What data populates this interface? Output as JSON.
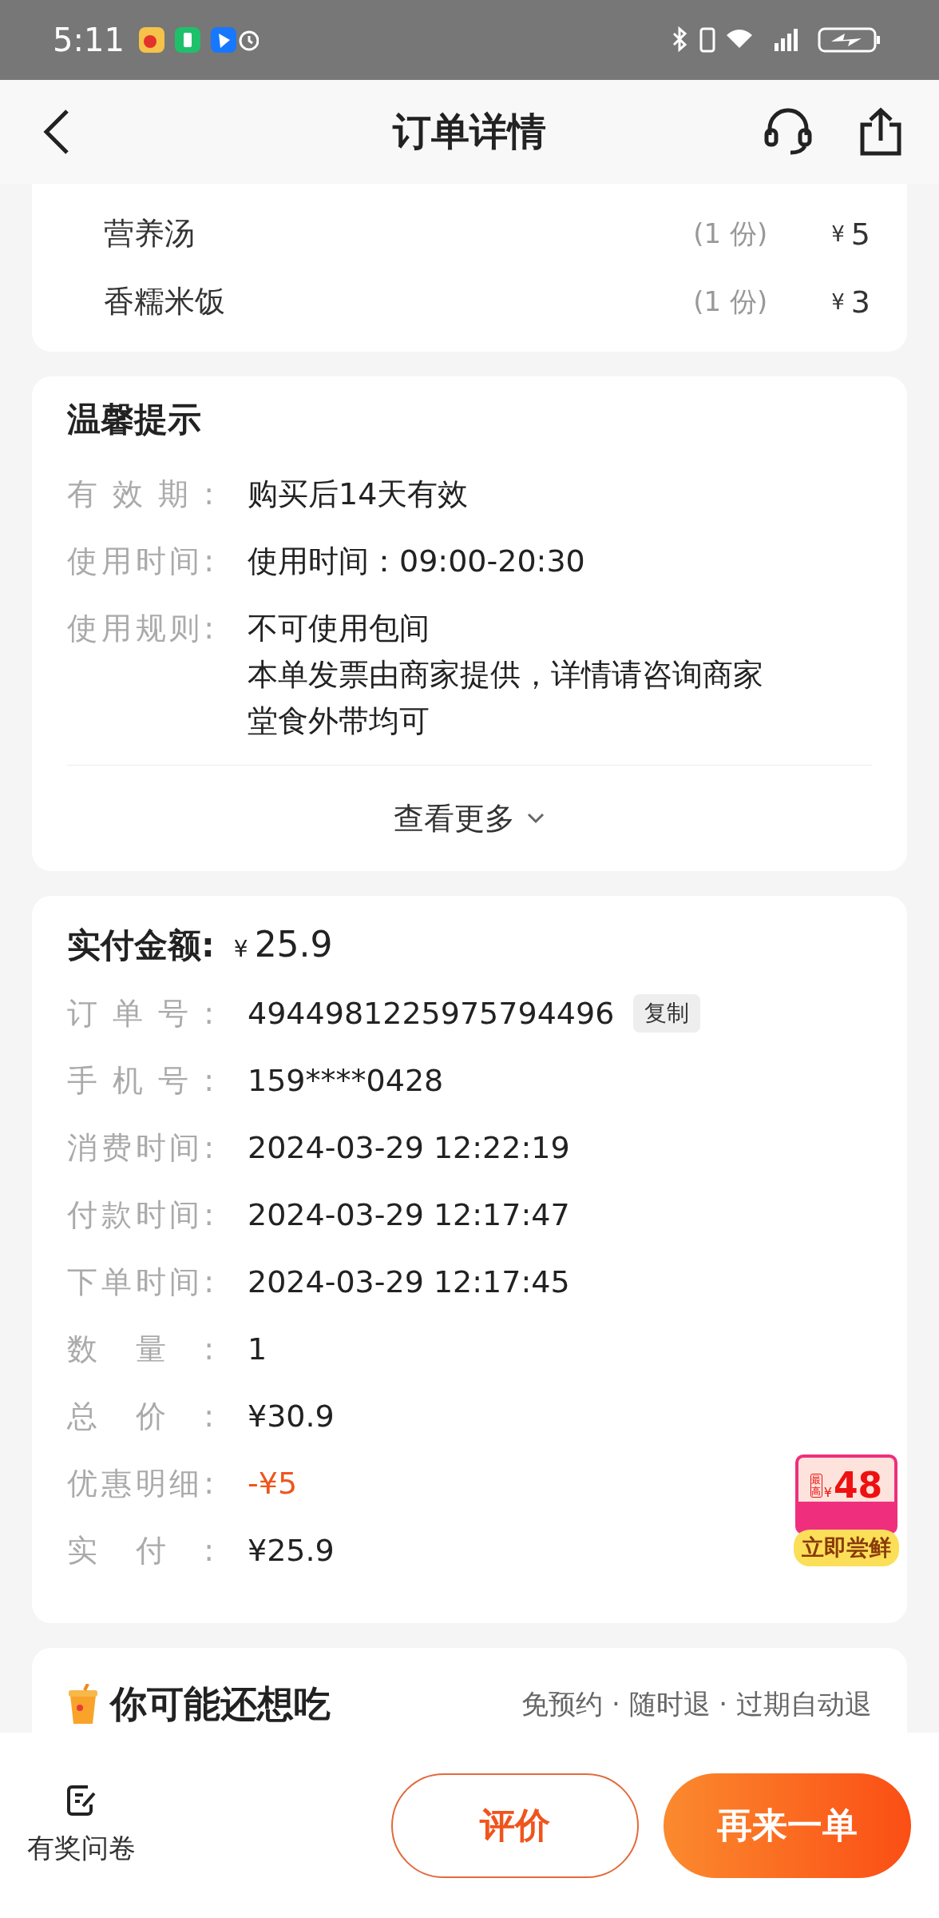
{
  "status_bar": {
    "time": "5:11"
  },
  "header": {
    "title": "订单详情"
  },
  "items": [
    {
      "name": "营养汤",
      "qty": "(1 份)",
      "currency": "¥",
      "price": "5"
    },
    {
      "name": "香糯米饭",
      "qty": "(1 份)",
      "currency": "¥",
      "price": "3"
    }
  ],
  "tips": {
    "title": "温馨提示",
    "rows": [
      {
        "label": "有效期:",
        "lines": [
          "购买后14天有效"
        ]
      },
      {
        "label": "使用时间:",
        "lines": [
          "使用时间：09:00-20:30"
        ]
      },
      {
        "label": "使用规则:",
        "lines": [
          "不可使用包间",
          "本单发票由商家提供，详情请咨询商家",
          "堂食外带均可"
        ]
      }
    ],
    "more": "查看更多"
  },
  "payment": {
    "title": "实付金额:",
    "currency": "¥",
    "amount": "25.9",
    "rows": [
      {
        "label": "订单号:",
        "value": "4944981225975794496",
        "kind": "copyable",
        "action": "复制"
      },
      {
        "label": "手机号:",
        "value": "159****0428",
        "kind": "plain"
      },
      {
        "label": "消费时间:",
        "value": "2024-03-29 12:22:19",
        "kind": "plain"
      },
      {
        "label": "付款时间:",
        "value": "2024-03-29 12:17:47",
        "kind": "plain"
      },
      {
        "label": "下单时间:",
        "value": "2024-03-29 12:17:45",
        "kind": "plain"
      },
      {
        "label": "数量:",
        "value": "1",
        "kind": "plain"
      },
      {
        "label": "总价:",
        "value": "¥30.9",
        "kind": "plain"
      },
      {
        "label": "优惠明细:",
        "value": "-¥5",
        "kind": "discount"
      },
      {
        "label": "实付:",
        "value": "¥25.9",
        "kind": "plain"
      }
    ]
  },
  "promo_badge": {
    "tag": "最高",
    "currency": "¥",
    "amount": "48",
    "cta": "立即尝鲜"
  },
  "recommend": {
    "title": "你可能还想吃",
    "features": "免预约 · 随时退 · 过期自动退"
  },
  "bottom_bar": {
    "survey": "有奖问卷",
    "buttons": [
      {
        "label": "评价",
        "kind": "outline"
      },
      {
        "label": "再来一单",
        "kind": "primary"
      }
    ]
  }
}
